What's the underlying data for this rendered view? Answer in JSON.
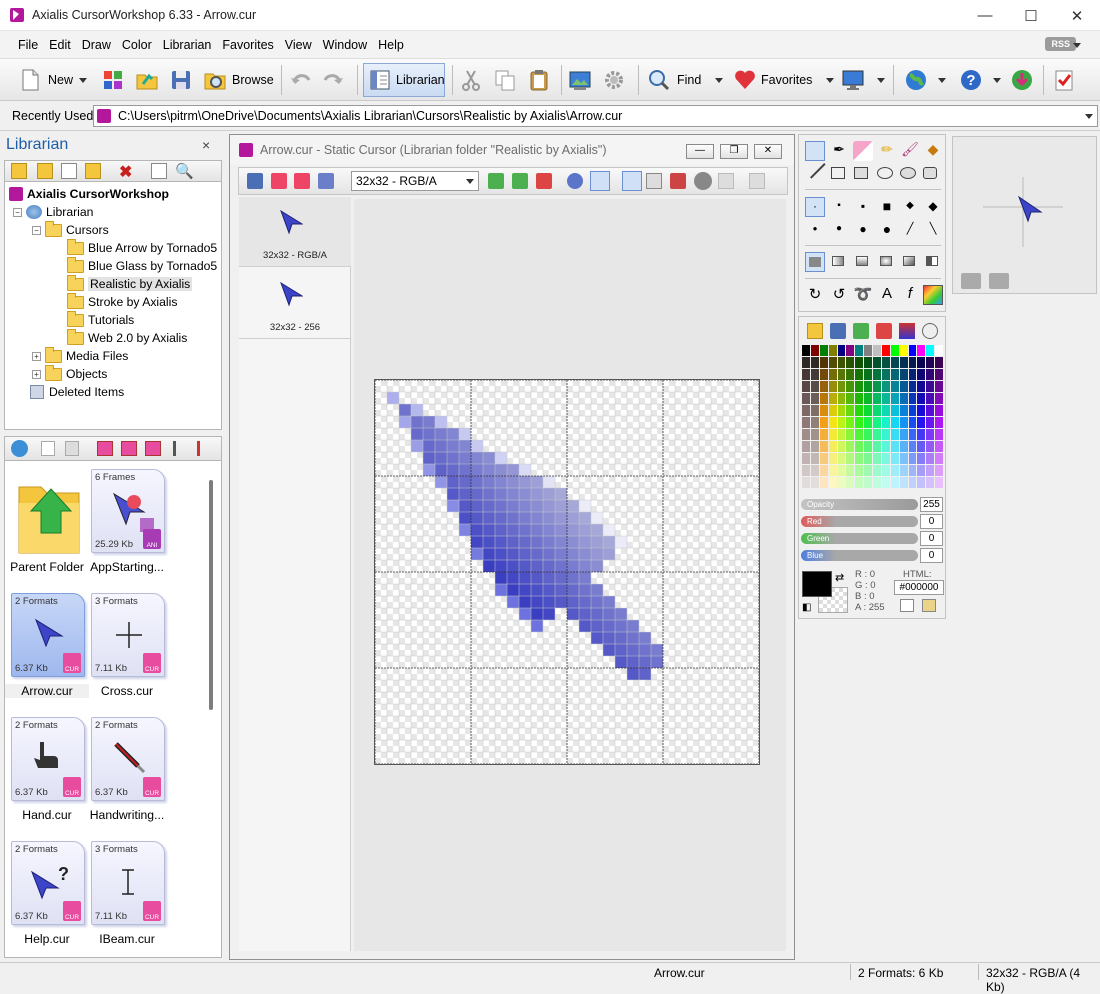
{
  "window": {
    "title": "Axialis CursorWorkshop 6.33 - Arrow.cur",
    "minimize": "—",
    "maximize": "☐",
    "close": "✕"
  },
  "menu": [
    "File",
    "Edit",
    "Draw",
    "Color",
    "Librarian",
    "Favorites",
    "View",
    "Window",
    "Help"
  ],
  "rss": "RSS",
  "toolbar": {
    "new": "New",
    "browse": "Browse",
    "librarian": "Librarian",
    "find": "Find",
    "favorites": "Favorites"
  },
  "recent": {
    "label": "Recently Used",
    "path": "C:\\Users\\pitrm\\OneDrive\\Documents\\Axialis Librarian\\Cursors\\Realistic by Axialis\\Arrow.cur"
  },
  "librarian": {
    "title": "Librarian",
    "close": "×",
    "tree": {
      "root": "Axialis CursorWorkshop",
      "librarian": "Librarian",
      "cursors": "Cursors",
      "folders": [
        "Blue Arrow by Tornado5",
        "Blue Glass by Tornado5",
        "Realistic by Axialis",
        "Stroke by Axialis",
        "Tutorials",
        "Web 2.0 by Axialis"
      ],
      "media": "Media Files",
      "objects": "Objects",
      "deleted": "Deleted Items"
    },
    "thumbs": [
      {
        "caption": "Parent Folder"
      },
      {
        "caption": "AppStarting...",
        "formats": "6 Frames",
        "size": "25.29 Kb"
      },
      {
        "caption": "Arrow.cur",
        "formats": "2 Formats",
        "size": "6.37 Kb"
      },
      {
        "caption": "Cross.cur",
        "formats": "3 Formats",
        "size": "7.11 Kb"
      },
      {
        "caption": "Hand.cur",
        "formats": "2 Formats",
        "size": "6.37 Kb"
      },
      {
        "caption": "Handwriting...",
        "formats": "2 Formats",
        "size": "6.37 Kb"
      },
      {
        "caption": "Help.cur",
        "formats": "2 Formats",
        "size": "6.37 Kb"
      },
      {
        "caption": "IBeam.cur",
        "formats": "3 Formats",
        "size": "7.11 Kb"
      }
    ]
  },
  "doc": {
    "title": "Arrow.cur - Static Cursor (Librarian folder \"Realistic by Axialis\")",
    "format_select": "32x32 - RGB/A",
    "formats": [
      "32x32 - RGB/A",
      "32x32 - 256"
    ],
    "min": "—",
    "restore": "❐",
    "close": "✕"
  },
  "color": {
    "opacity_label": "Opacity",
    "opacity": "255",
    "red_label": "Red",
    "red": "0",
    "green_label": "Green",
    "green": "0",
    "blue_label": "Blue",
    "blue": "0",
    "r": "R :  0",
    "g": "G :  0",
    "b": "B :  0",
    "a": "A : 255",
    "html_label": "HTML:",
    "html": "#000000",
    "current": "#000000"
  },
  "status": {
    "file": "Arrow.cur",
    "formats": "2 Formats: 6 Kb",
    "size": "32x32 - RGB/A (4 Kb)"
  }
}
